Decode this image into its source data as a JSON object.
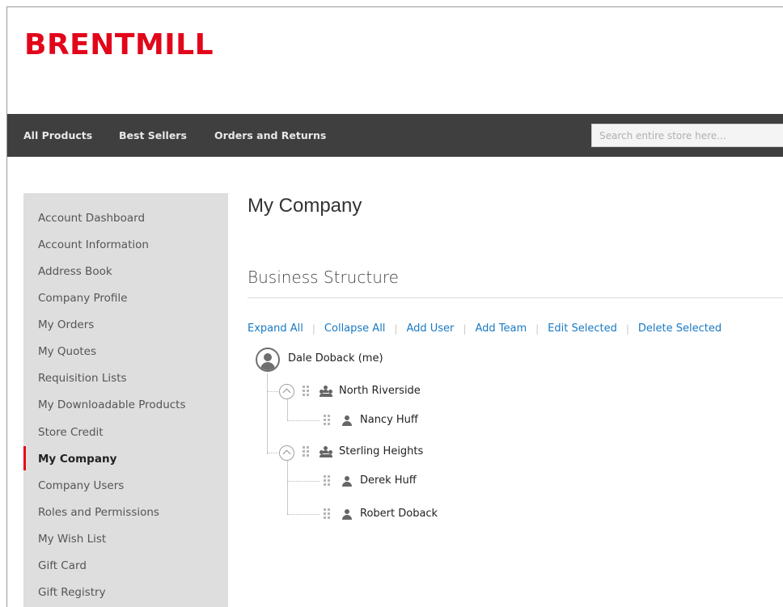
{
  "brand": {
    "name": "BRENTMILL",
    "color": "#e2061b"
  },
  "nav": {
    "items": [
      "All Products",
      "Best Sellers",
      "Orders and Returns"
    ],
    "search_placeholder": "Search entire store here..."
  },
  "sidebar": {
    "items": [
      "Account Dashboard",
      "Account Information",
      "Address Book",
      "Company Profile",
      "My Orders",
      "My Quotes",
      "Requisition Lists",
      "My Downloadable Products",
      "Store Credit",
      "My Company",
      "Company Users",
      "Roles and Permissions",
      "My Wish List",
      "Gift Card",
      "Gift Registry"
    ],
    "active": "My Company"
  },
  "main": {
    "page_title": "My Company",
    "section_title": "Business Structure",
    "actions": [
      "Expand All",
      "Collapse All",
      "Add User",
      "Add Team",
      "Edit Selected",
      "Delete Selected"
    ],
    "tree": {
      "root": "Dale Doback (me)",
      "teams": [
        {
          "name": "North Riverside",
          "users": [
            "Nancy Huff"
          ]
        },
        {
          "name": "Sterling Heights",
          "users": [
            "Derek Huff",
            "Robert Doback"
          ]
        }
      ]
    }
  },
  "colors": {
    "nav_bg": "#3f3f3f",
    "sidebar_bg": "#dedede",
    "link": "#1979c3"
  }
}
